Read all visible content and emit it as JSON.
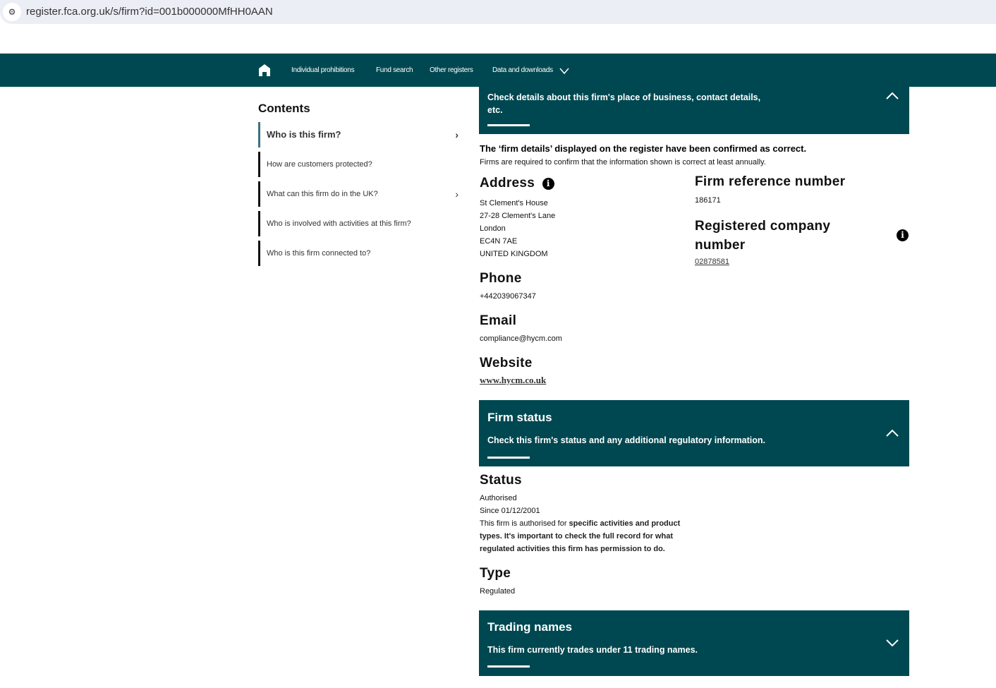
{
  "browser": {
    "url": "register.fca.org.uk/s/firm?id=001b000000MfHH0AAN"
  },
  "nav": {
    "items": [
      "Individual prohibitions",
      "Fund search",
      "Other registers",
      "Data and downloads"
    ]
  },
  "contents": {
    "title": "Contents",
    "items": [
      "Who is this firm?",
      "How are customers protected?",
      "What can this firm do in the UK?",
      "Who is involved with activities at this firm?",
      "Who is this firm connected to?"
    ]
  },
  "details_panel": {
    "subtitle": "Check details about this firm's place of business, contact details, etc."
  },
  "confirmation": {
    "title": "The ‘firm details’ displayed on the register have been confirmed as correct.",
    "text": "Firms are required to confirm that the information shown is correct at least annually."
  },
  "address": {
    "label": "Address",
    "lines": [
      "St Clement's House",
      "27-28 Clement's Lane",
      "London",
      "EC4N 7AE",
      "UNITED KINGDOM"
    ]
  },
  "frn": {
    "label": "Firm reference number",
    "value": "186171"
  },
  "company": {
    "label": "Registered company number",
    "value": "02878581"
  },
  "phone": {
    "label": "Phone",
    "value": "+442039067347"
  },
  "email": {
    "label": "Email",
    "value": "compliance@hycm.com"
  },
  "website": {
    "label": "Website",
    "value": "www.hycm.co.uk"
  },
  "status_panel": {
    "title": "Firm status",
    "subtitle": "Check this firm's status and any additional regulatory information."
  },
  "status": {
    "label": "Status",
    "value": "Authorised",
    "since": "Since 01/12/2001",
    "note_plain": "This firm is authorised for ",
    "note_bold": "specific activities and product types. It's important to check the full record for what regulated activities this firm has permission to do."
  },
  "type": {
    "label": "Type",
    "value": "Regulated"
  },
  "trading_panel": {
    "title": "Trading names",
    "subtitle": "This firm currently trades under 11 trading names."
  }
}
